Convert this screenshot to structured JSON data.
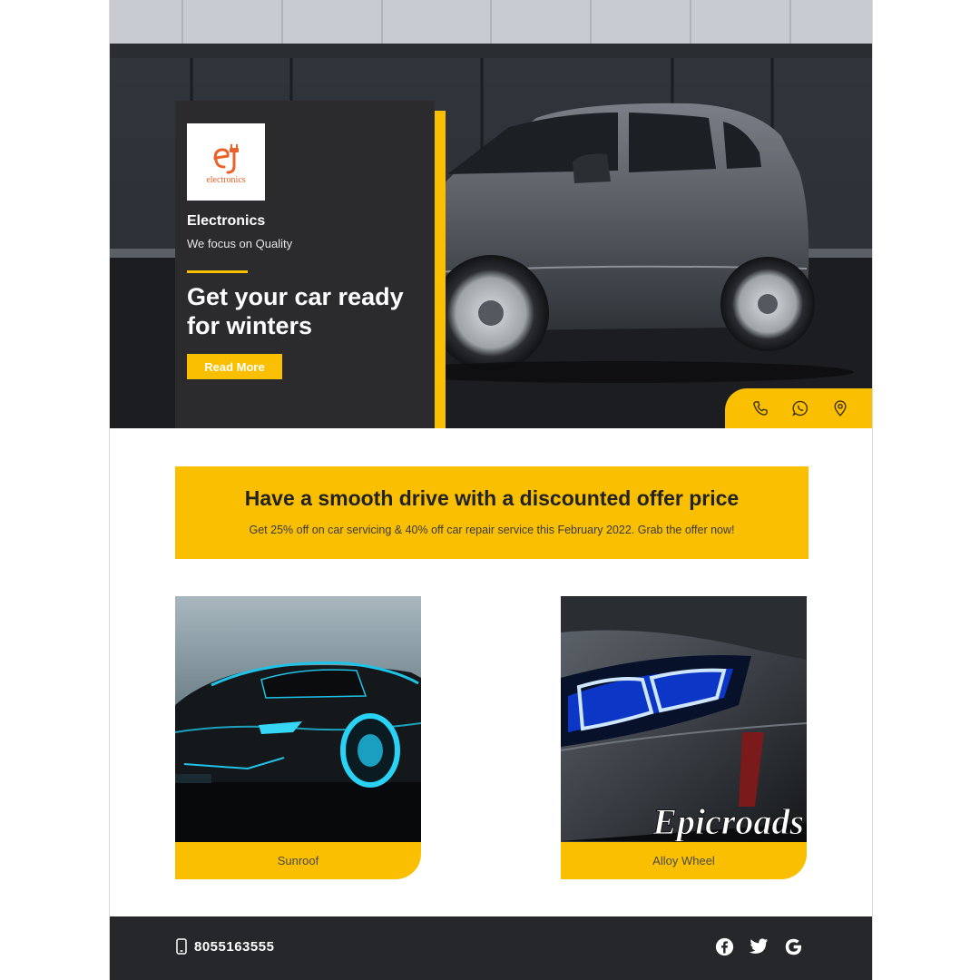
{
  "brand": {
    "logo_letter": "ej",
    "logo_word": "electronics",
    "name": "Electronics",
    "tagline": "We focus on Quality"
  },
  "hero": {
    "headline": "Get your car ready for winters",
    "cta_label": "Read More",
    "contact_icons": [
      "phone-icon",
      "whatsapp-icon",
      "location-pin-icon"
    ]
  },
  "offer": {
    "title": "Have a smooth drive with a discounted offer price",
    "subtitle": "Get 25% off on car servicing & 40% off car repair service this February 2022. Grab the offer now!"
  },
  "products": [
    {
      "label": "Sunroof"
    },
    {
      "label": "Alloy Wheel",
      "watermark": "Epicroads"
    }
  ],
  "footer": {
    "phone": "8055163555",
    "social_icons": [
      "facebook-icon",
      "twitter-icon",
      "google-icon"
    ]
  },
  "colors": {
    "accent": "#f9bf00",
    "card_dark": "#2b2b2e",
    "footer_dark": "#26272b",
    "logo_orange": "#e8622a"
  }
}
